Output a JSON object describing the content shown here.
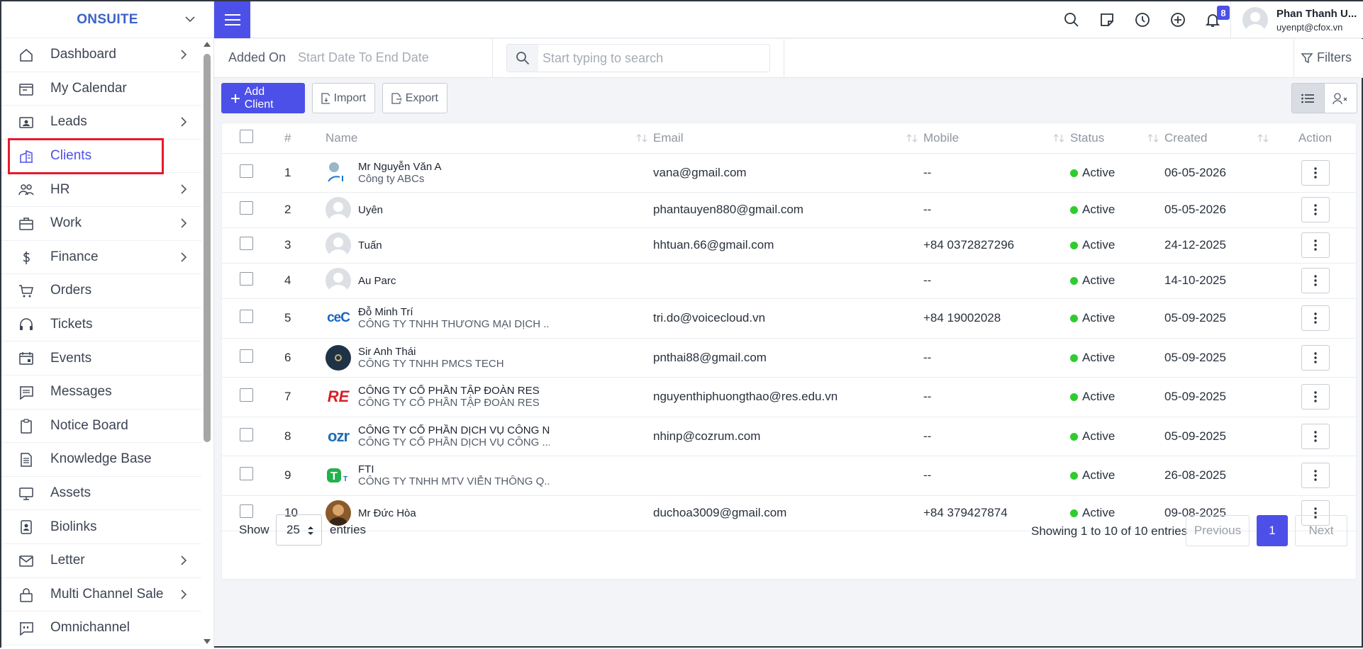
{
  "brand": "ONSUITE",
  "sidebar": {
    "items": [
      {
        "label": "Dashboard",
        "icon": "home-icon",
        "arrow": true
      },
      {
        "label": "My Calendar",
        "icon": "calendar-icon",
        "arrow": false
      },
      {
        "label": "Leads",
        "icon": "id-card-icon",
        "arrow": true
      },
      {
        "label": "Clients",
        "icon": "building-icon",
        "arrow": false,
        "active": true
      },
      {
        "label": "HR",
        "icon": "users-icon",
        "arrow": true
      },
      {
        "label": "Work",
        "icon": "briefcase-icon",
        "arrow": true
      },
      {
        "label": "Finance",
        "icon": "dollar-icon",
        "arrow": true
      },
      {
        "label": "Orders",
        "icon": "cart-icon",
        "arrow": false
      },
      {
        "label": "Tickets",
        "icon": "headset-icon",
        "arrow": false
      },
      {
        "label": "Events",
        "icon": "calendar-event-icon",
        "arrow": false
      },
      {
        "label": "Messages",
        "icon": "message-icon",
        "arrow": false
      },
      {
        "label": "Notice Board",
        "icon": "clipboard-icon",
        "arrow": false
      },
      {
        "label": "Knowledge Base",
        "icon": "document-icon",
        "arrow": false
      },
      {
        "label": "Assets",
        "icon": "monitor-icon",
        "arrow": false
      },
      {
        "label": "Biolinks",
        "icon": "badge-icon",
        "arrow": false
      },
      {
        "label": "Letter",
        "icon": "envelope-icon",
        "arrow": true
      },
      {
        "label": "Multi Channel Sale",
        "icon": "lock-bag-icon",
        "arrow": true
      },
      {
        "label": "Omnichannel",
        "icon": "chat-quote-icon",
        "arrow": false
      }
    ]
  },
  "topbar": {
    "notification_count": "8",
    "user_name": "Phan Thanh U...",
    "user_email": "uyenpt@cfox.vn"
  },
  "filterbar": {
    "added_on": "Added On",
    "date_range": "Start Date To End Date",
    "search_placeholder": "Start typing to search",
    "filters": "Filters"
  },
  "actions": {
    "add": "Add Client",
    "import": "Import",
    "export": "Export"
  },
  "table": {
    "headers": {
      "num": "#",
      "name": "Name",
      "email": "Email",
      "mobile": "Mobile",
      "status": "Status",
      "created": "Created",
      "action": "Action"
    },
    "rows": [
      {
        "num": "1",
        "name": "Mr Nguyễn Văn A",
        "company": "Công ty ABCs",
        "email": "vana@gmail.com",
        "mobile": "--",
        "status": "Active",
        "created": "06-05-2026",
        "avatar": "logo-1"
      },
      {
        "num": "2",
        "name": "Uyên",
        "company": "",
        "email": "phantauyen880@gmail.com",
        "mobile": "--",
        "status": "Active",
        "created": "05-05-2026",
        "avatar": "default"
      },
      {
        "num": "3",
        "name": "Tuấn",
        "company": "",
        "email": "hhtuan.66@gmail.com",
        "mobile": "+84 0372827296",
        "status": "Active",
        "created": "24-12-2025",
        "avatar": "default"
      },
      {
        "num": "4",
        "name": "Au Parc",
        "company": "",
        "email": "",
        "mobile": "--",
        "status": "Active",
        "created": "14-10-2025",
        "avatar": "default"
      },
      {
        "num": "5",
        "name": "Đỗ Minh Trí",
        "company": "CÔNG TY TNHH THƯƠNG MẠI DỊCH ...",
        "email": "tri.do@voicecloud.vn",
        "mobile": "+84 19002028",
        "status": "Active",
        "created": "05-09-2025",
        "avatar": "ceC"
      },
      {
        "num": "6",
        "name": "Sir Anh Thái",
        "company": "CÔNG TY TNHH PMCS TECH",
        "email": "pnthai88@gmail.com",
        "mobile": "--",
        "status": "Active",
        "created": "05-09-2025",
        "avatar": "dark"
      },
      {
        "num": "7",
        "name": "CÔNG TY CỔ PHẦN TẬP ĐOÀN RES",
        "company": "CÔNG TY CỔ PHẦN TẬP ĐOÀN RES",
        "email": "nguyenthiphuongthao@res.edu.vn",
        "mobile": "--",
        "status": "Active",
        "created": "05-09-2025",
        "avatar": "RE"
      },
      {
        "num": "8",
        "name": "CÔNG TY CỔ PHẦN DỊCH VỤ CÔNG NG",
        "company": "CÔNG TY CỔ PHẦN DỊCH VỤ CÔNG ...",
        "email": "nhinp@cozrum.com",
        "mobile": "--",
        "status": "Active",
        "created": "05-09-2025",
        "avatar": "ozr"
      },
      {
        "num": "9",
        "name": "FTI",
        "company": "CÔNG TY TNHH MTV VIỄN THÔNG Q...",
        "email": "",
        "mobile": "--",
        "status": "Active",
        "created": "26-08-2025",
        "avatar": "T"
      },
      {
        "num": "10",
        "name": "Mr Đức Hòa",
        "company": "",
        "email": "duchoa3009@gmail.com",
        "mobile": "+84 379427874",
        "status": "Active",
        "created": "09-08-2025",
        "avatar": "photo"
      }
    ]
  },
  "footer": {
    "show": "Show",
    "page_size": "25",
    "entries": "entries",
    "showing": "Showing 1 to 10 of 10 entries",
    "previous": "Previous",
    "page": "1",
    "next": "Next"
  },
  "colors": {
    "accent": "#4c50e8",
    "active": "#2ecc2e",
    "highlight": "#e8192c"
  }
}
